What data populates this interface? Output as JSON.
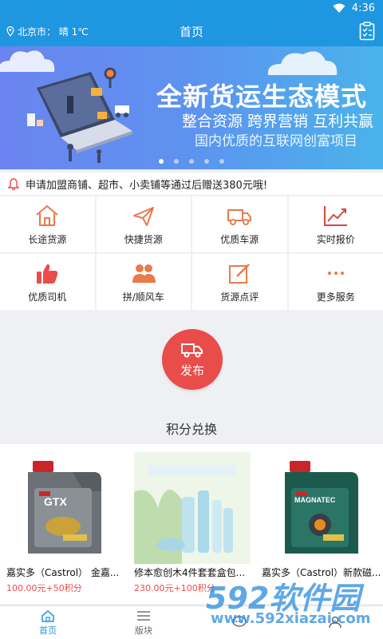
{
  "status_bar": {
    "time": "4:36"
  },
  "header": {
    "location": "北京市：  晴 1℃",
    "title": "首页"
  },
  "banner": {
    "headline": "全新货运生态模式",
    "subtitle": "整合资源  跨界营销  互利共赢",
    "tagline": "国内优质的互联网创富项目",
    "slides": 5,
    "active_slide": 0
  },
  "notice": {
    "text": "申请加盟商铺、超市、小卖铺等通过后赠送380元哦!"
  },
  "services": [
    {
      "label": "长途货源",
      "icon": "house-icon"
    },
    {
      "label": "快捷货源",
      "icon": "send-icon"
    },
    {
      "label": "优质车源",
      "icon": "truck-icon"
    },
    {
      "label": "实时报价",
      "icon": "trend-chart-icon"
    },
    {
      "label": "优质司机",
      "icon": "thumbs-up-icon"
    },
    {
      "label": "拼/顺风车",
      "icon": "people-icon"
    },
    {
      "label": "货源点评",
      "icon": "edit-icon"
    },
    {
      "label": "更多服务",
      "icon": "more-icon"
    }
  ],
  "publish": {
    "label": "发布"
  },
  "points": {
    "title": "积分兑换"
  },
  "products": [
    {
      "name": "嘉实多（Castrol） 金嘉...",
      "price": "100.00元+50积分"
    },
    {
      "name": "修本愈创木4件套套盒包...",
      "price": "230.00元+100积分"
    },
    {
      "name": "嘉实多（Castrol）新款磁...",
      "price": ""
    }
  ],
  "tabbar": [
    {
      "label": "首页",
      "active": true
    },
    {
      "label": "版块",
      "active": false
    },
    {
      "label": "",
      "active": false
    },
    {
      "label": "",
      "active": false
    }
  ],
  "watermark": {
    "main": "592软件园",
    "url": "www.592xiazai.com"
  },
  "colors": {
    "primary": "#1e96e0",
    "accent": "#e84d4a",
    "icon_orange": "#e87a4c"
  }
}
